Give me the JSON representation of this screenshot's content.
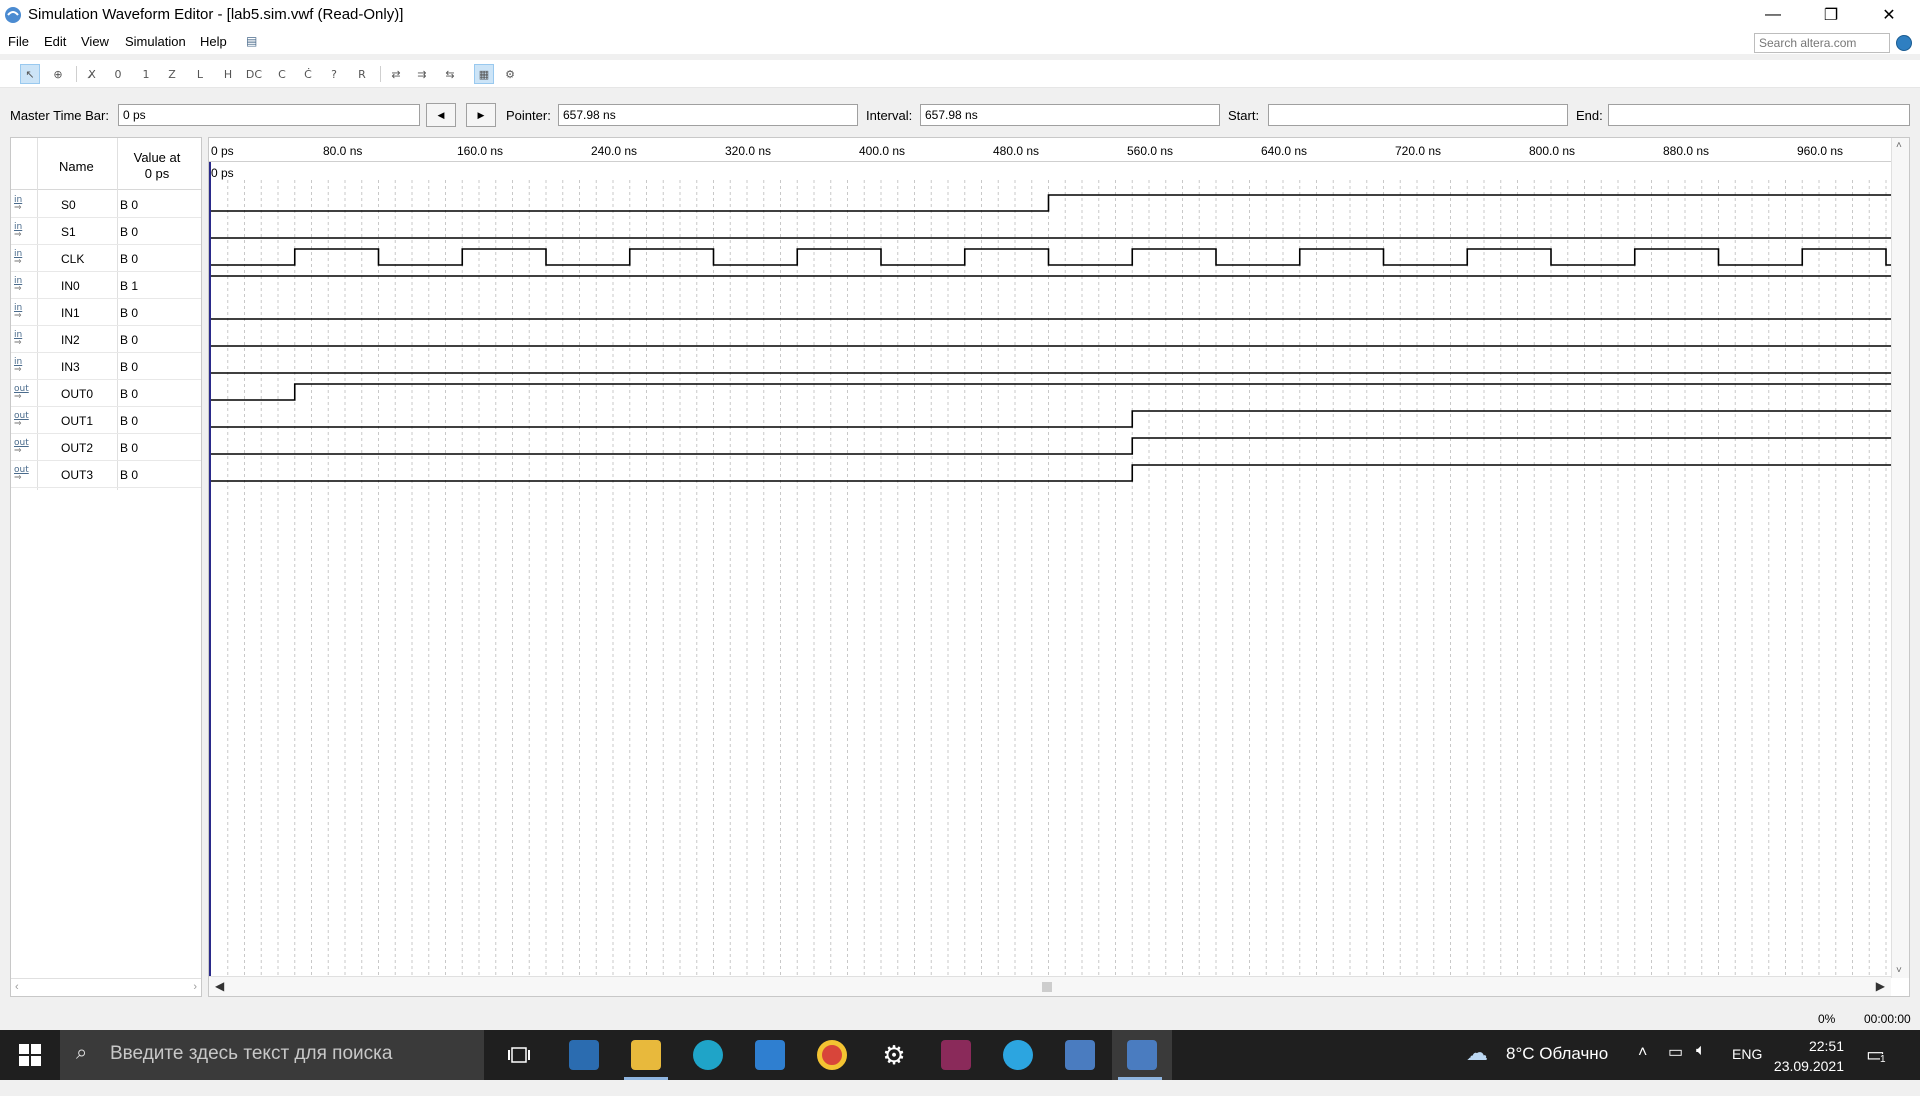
{
  "window": {
    "title": "Simulation Waveform Editor - [lab5.sim.vwf (Read-Only)]",
    "minimize": "—",
    "restore": "❐",
    "close": "✕"
  },
  "menu": {
    "items": [
      "File",
      "Edit",
      "View",
      "Simulation",
      "Help"
    ],
    "search_placeholder": "Search altera.com"
  },
  "timebar": {
    "master_label": "Master Time Bar:",
    "master_value": "0 ps",
    "prev_symbol": "◀",
    "next_symbol": "▶",
    "pointer_label": "Pointer:",
    "pointer_value": "657.98 ns",
    "interval_label": "Interval:",
    "interval_value": "657.98 ns",
    "start_label": "Start:",
    "start_value": "",
    "end_label": "End:",
    "end_value": ""
  },
  "signal_table": {
    "name_header": "Name",
    "value_header_line1": "Value at",
    "value_header_line2": "0 ps",
    "signals": [
      {
        "dir": "in",
        "name": "S0",
        "value": "B 0"
      },
      {
        "dir": "in",
        "name": "S1",
        "value": "B 0"
      },
      {
        "dir": "in",
        "name": "CLK",
        "value": "B 0"
      },
      {
        "dir": "in",
        "name": "IN0",
        "value": "B 1"
      },
      {
        "dir": "in",
        "name": "IN1",
        "value": "B 0"
      },
      {
        "dir": "in",
        "name": "IN2",
        "value": "B 0"
      },
      {
        "dir": "in",
        "name": "IN3",
        "value": "B 0"
      },
      {
        "dir": "out",
        "name": "OUT0",
        "value": "B 0"
      },
      {
        "dir": "out",
        "name": "OUT1",
        "value": "B 0"
      },
      {
        "dir": "out",
        "name": "OUT2",
        "value": "B 0"
      },
      {
        "dir": "out",
        "name": "OUT3",
        "value": "B 0"
      }
    ]
  },
  "waveform": {
    "time_unit": "ns",
    "visible_range_ns": [
      0,
      1000
    ],
    "tick_labels": [
      "0 ps",
      "80.0 ns",
      "160.0 ns",
      "240.0 ns",
      "320.0 ns",
      "400.0 ns",
      "480.0 ns",
      "560.0 ns",
      "640.0 ns",
      "720.0 ns",
      "800.0 ns",
      "880.0 ns",
      "960.0 ns"
    ],
    "tick_values_ns": [
      0,
      80,
      160,
      240,
      320,
      400,
      480,
      560,
      640,
      720,
      800,
      880,
      960
    ],
    "cursor_label": "0 ps",
    "traces": [
      {
        "name": "S0",
        "transitions": [
          [
            0,
            0
          ],
          [
            500,
            1
          ]
        ]
      },
      {
        "name": "S1",
        "transitions": [
          [
            0,
            0
          ]
        ]
      },
      {
        "name": "CLK",
        "clock": {
          "period_ns": 100,
          "high_ns": 50,
          "first_rise_ns": 50
        }
      },
      {
        "name": "IN0",
        "transitions": [
          [
            0,
            1
          ]
        ]
      },
      {
        "name": "IN1",
        "transitions": [
          [
            0,
            0
          ]
        ]
      },
      {
        "name": "IN2",
        "transitions": [
          [
            0,
            0
          ]
        ]
      },
      {
        "name": "IN3",
        "transitions": [
          [
            0,
            0
          ]
        ]
      },
      {
        "name": "OUT0",
        "transitions": [
          [
            0,
            0
          ],
          [
            50,
            1
          ]
        ]
      },
      {
        "name": "OUT1",
        "transitions": [
          [
            0,
            0
          ],
          [
            550,
            1
          ]
        ]
      },
      {
        "name": "OUT2",
        "transitions": [
          [
            0,
            0
          ],
          [
            550,
            1
          ]
        ]
      },
      {
        "name": "OUT3",
        "transitions": [
          [
            0,
            0
          ],
          [
            550,
            1
          ]
        ]
      }
    ]
  },
  "status": {
    "progress": "0%",
    "elapsed": "00:00:00"
  },
  "taskbar": {
    "search_placeholder": "Введите здесь текст для поиска",
    "weather": "8°C  Облачно",
    "language": "ENG",
    "time": "22:51",
    "date": "23.09.2021",
    "notifications": "1"
  },
  "colors": {
    "waveform_line": "#000000",
    "grid": "#c8c8c8",
    "taskbar": "#1f1f1f",
    "active_underline": "#8fb5e0"
  }
}
